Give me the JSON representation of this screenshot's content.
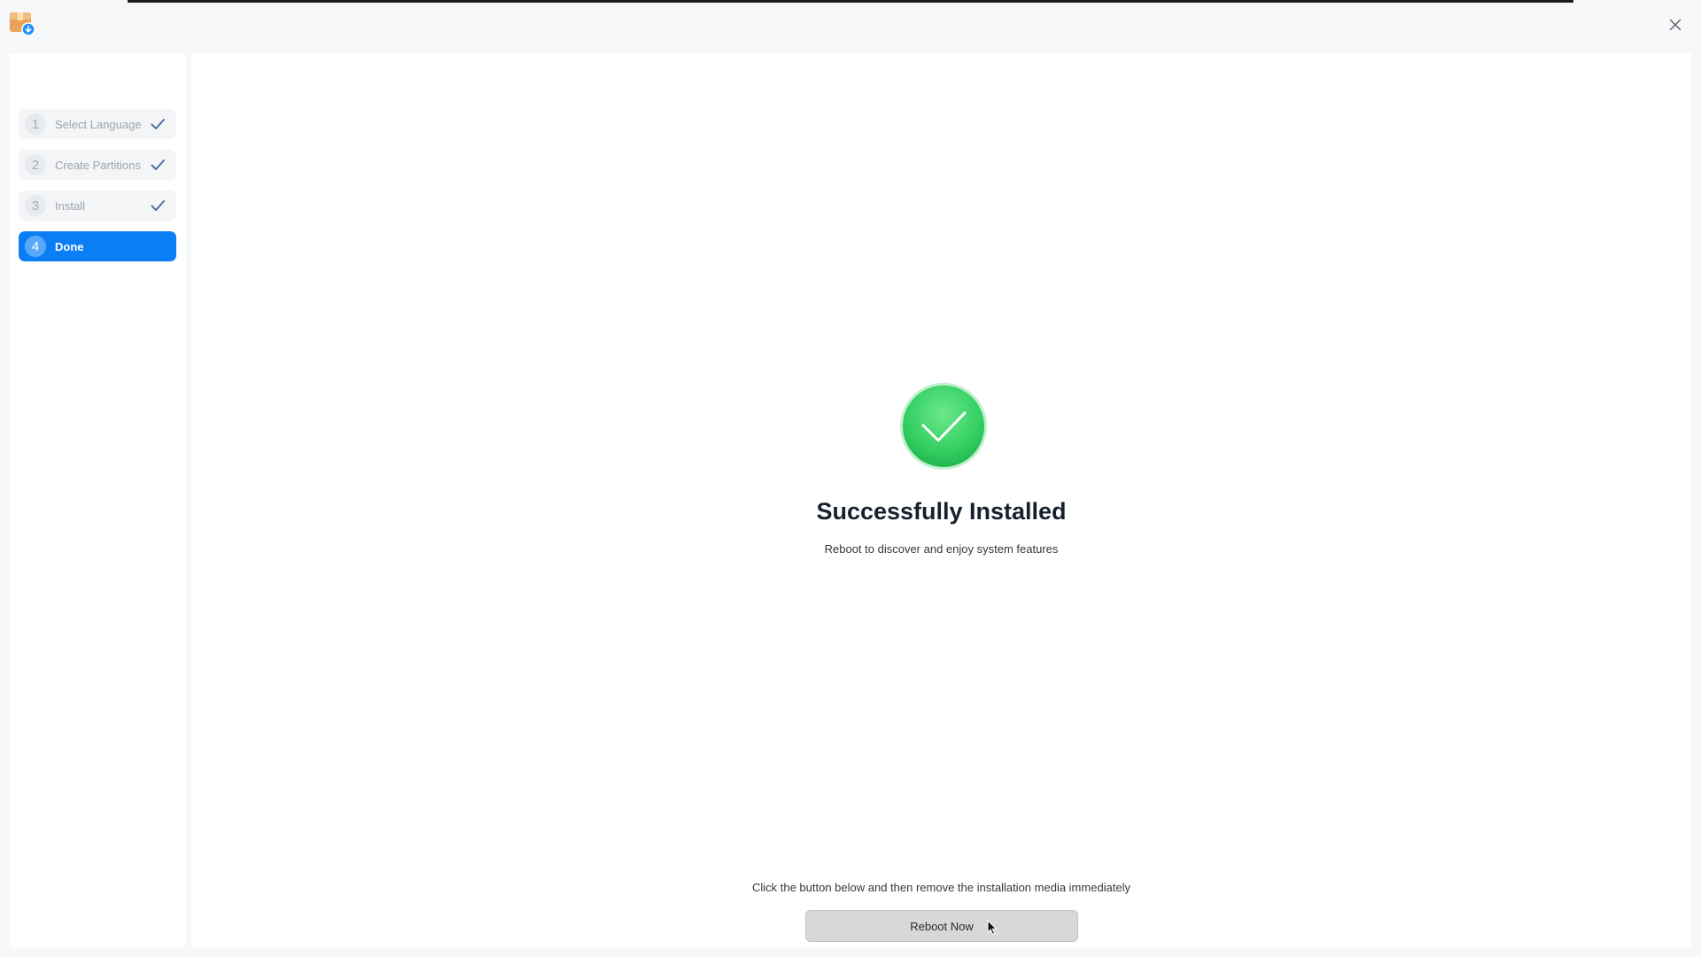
{
  "window": {
    "app_icon": "installer-package-icon",
    "close_icon": "close-icon"
  },
  "steps": [
    {
      "number": "1",
      "label": "Select Language",
      "state": "done"
    },
    {
      "number": "2",
      "label": "Create Partitions",
      "state": "done"
    },
    {
      "number": "3",
      "label": "Install",
      "state": "done"
    },
    {
      "number": "4",
      "label": "Done",
      "state": "active"
    }
  ],
  "main": {
    "status_icon": "success-check-icon",
    "title": "Successfully Installed",
    "subtitle": "Reboot to discover and enjoy system features",
    "hint": "Click the button below and then remove the installation media immediately",
    "reboot_label": "Reboot Now"
  },
  "colors": {
    "accent": "#0b7ef6",
    "success": "#3cd46a"
  }
}
